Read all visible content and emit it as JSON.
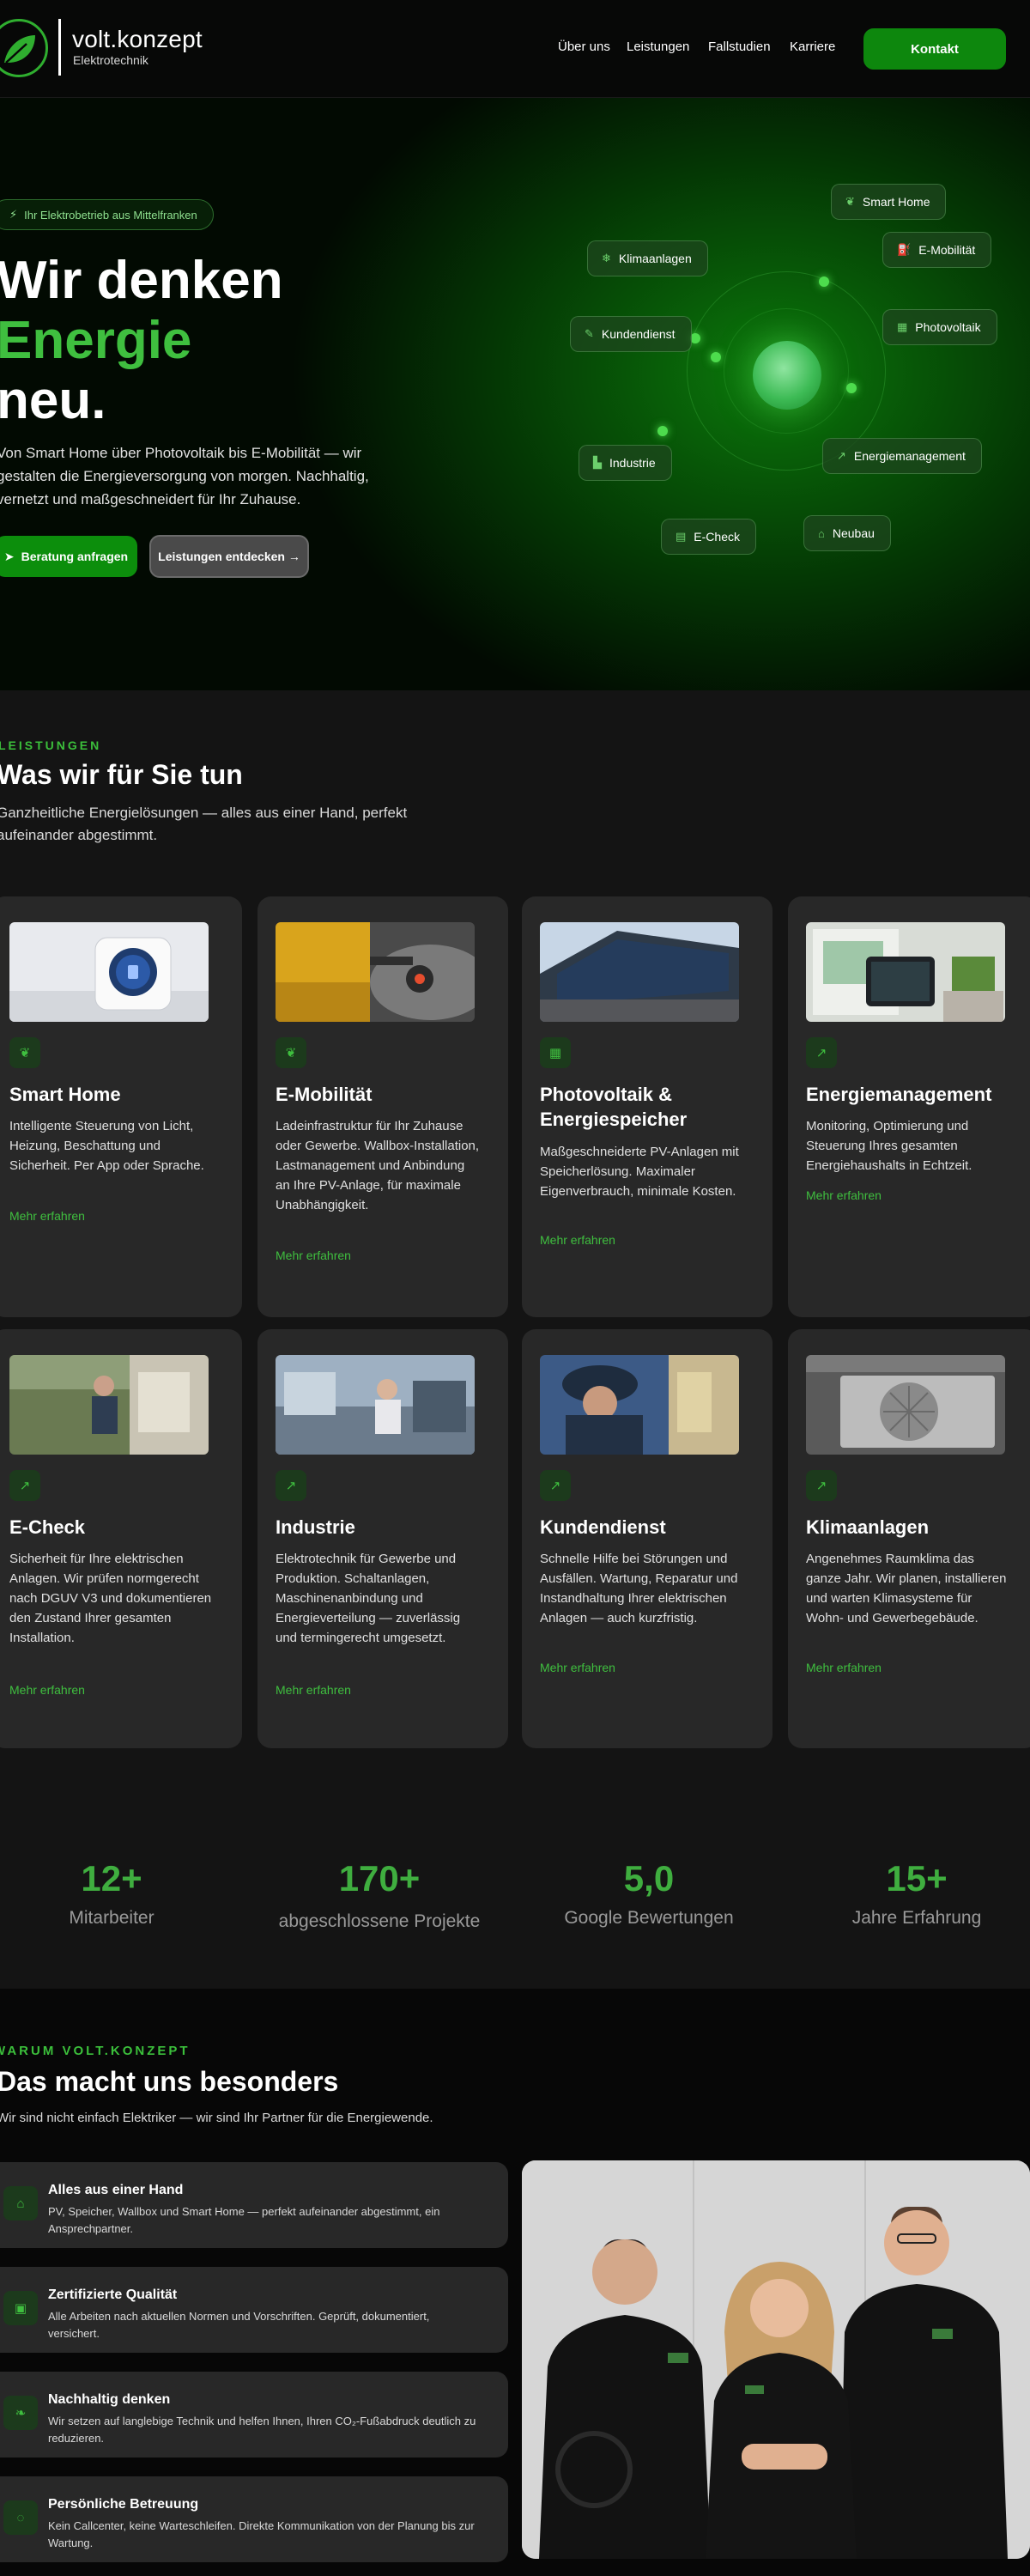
{
  "header": {
    "brand_name": "volt.konzept",
    "brand_sub": "Elektrotechnik",
    "nav": [
      "Über uns",
      "Leistungen",
      "Fallstudien",
      "Karriere"
    ],
    "cta": "Kontakt"
  },
  "hero": {
    "badge": "Ihr Elektrobetrieb aus Mittelfranken",
    "headline_1": "Wir denken",
    "headline_2": "Energie",
    "headline_3": "neu.",
    "text": "Von Smart Home über Photovoltaik bis E-Mobilität — wir gestalten die Energieversorgung von morgen. Nachhaltig, vernetzt und maßgeschneidert für Ihr Zuhause.",
    "primary_cta": "Beratung anfragen",
    "secondary_cta": "Leistungen entdecken →",
    "pills": {
      "smart_home": "Smart Home",
      "e_mobilitaet": "E-Mobilität",
      "klimaanlagen": "Klimaanlagen",
      "kundendienst": "Kundendienst",
      "photovoltaik": "Photovoltaik",
      "industrie": "Industrie",
      "energiemanagement": "Energiemanagement",
      "e_check": "E-Check",
      "neubau": "Neubau"
    }
  },
  "services": {
    "eyebrow": "LEISTUNGEN",
    "title": "Was wir für Sie tun",
    "lead": "Ganzheitliche Energielösungen — alles aus einer Hand, perfekt aufeinander abgestimmt.",
    "link_label": "Mehr erfahren",
    "cards": [
      {
        "title": "Smart Home",
        "text": "Intelligente Steuerung von Licht, Heizung, Beschattung und Sicherheit. Per App oder Sprache."
      },
      {
        "title": "E-Mobilität",
        "text": "Ladeinfrastruktur für Ihr Zuhause oder Gewerbe. Wallbox-Installation, Lastmanagement und Anbindung an Ihre PV-Anlage, für maximale Unabhängigkeit."
      },
      {
        "title": "Photovoltaik & Energiespeicher",
        "text": "Maßgeschneiderte PV-Anlagen mit Speicherlösung. Maximaler Eigenverbrauch, minimale Kosten."
      },
      {
        "title": "Energiemanagement",
        "text": "Monitoring, Optimierung und Steuerung Ihres gesamten Energiehaushalts in Echtzeit."
      },
      {
        "title": "E-Check",
        "text": "Sicherheit für Ihre elektrischen Anlagen. Wir prüfen normgerecht nach DGUV V3 und dokumentieren den Zustand Ihrer gesamten Installation."
      },
      {
        "title": "Industrie",
        "text": "Elektrotechnik für Gewerbe und Produktion. Schaltanlagen, Maschinenanbindung und Energieverteilung — zuverlässig und termingerecht umgesetzt."
      },
      {
        "title": "Kundendienst",
        "text": "Schnelle Hilfe bei Störungen und Ausfällen. Wartung, Reparatur und Instandhaltung Ihrer elektrischen Anlagen — auch kurzfristig."
      },
      {
        "title": "Klimaanlagen",
        "text": "Angenehmes Raumklima das ganze Jahr. Wir planen, installieren und warten Klimasysteme für Wohn- und Gewerbegebäude."
      }
    ]
  },
  "stats": [
    {
      "value": "12+",
      "label": "Mitarbeiter"
    },
    {
      "value": "170+",
      "label": "abgeschlossene Projekte"
    },
    {
      "value": "5,0",
      "label": "Google Bewertungen"
    },
    {
      "value": "15+",
      "label": "Jahre Erfahrung"
    }
  ],
  "why": {
    "eyebrow": "WARUM VOLT.KONZEPT",
    "title": "Das macht uns besonders",
    "lead": "Wir sind nicht einfach Elektriker — wir sind Ihr Partner für die Energiewende.",
    "items": [
      {
        "title": "Alles aus einer Hand",
        "text": "PV, Speicher, Wallbox und Smart Home — perfekt aufeinander abgestimmt, ein Ansprechpartner."
      },
      {
        "title": "Zertifizierte Qualität",
        "text": "Alle Arbeiten nach aktuellen Normen und Vorschriften. Geprüft, dokumentiert, versichert."
      },
      {
        "title": "Nachhaltig denken",
        "text": "Wir setzen auf langlebige Technik und helfen Ihnen, Ihren CO₂-Fußabdruck deutlich zu reduzieren."
      },
      {
        "title": "Persönliche Betreuung",
        "text": "Kein Callcenter, keine Warteschleifen. Direkte Kommunikation von der Planung bis zur Wartung."
      }
    ]
  },
  "colors": {
    "accent": "#3fbf3f",
    "button": "#0d870d",
    "card": "#282828",
    "background": "#141414"
  }
}
